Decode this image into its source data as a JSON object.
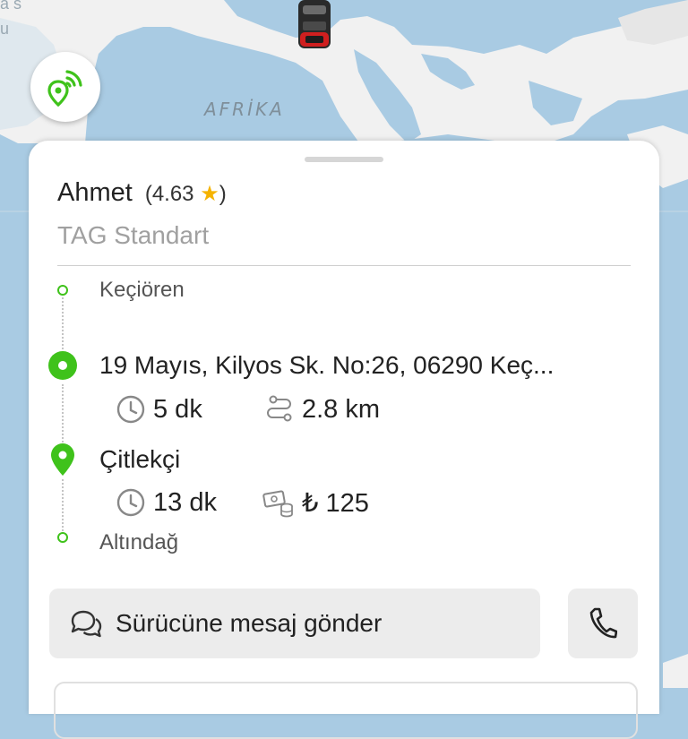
{
  "map": {
    "region_label": "AFRİKA",
    "edge_text_top": "a s",
    "edge_text_left": "u"
  },
  "colors": {
    "accent": "#3fc21b",
    "star": "#f5b300",
    "map_water": "#a9cbe3",
    "map_land": "#f2f2f2"
  },
  "driver": {
    "name": "Ahmet",
    "rating": "(4.63",
    "rating_close": ")",
    "service": "TAG Standart"
  },
  "route": {
    "previous_stop": "Keçiören",
    "pickup_address": "19 Mayıs, Kilyos Sk. No:26, 06290 Keç...",
    "pickup_time": "5 dk",
    "pickup_distance": "2.8 km",
    "destination": "Çitlekçi",
    "destination_time": "13 dk",
    "fare": "₺ 125",
    "next_stop": "Altındağ"
  },
  "actions": {
    "message_label": "Sürücüne mesaj gönder"
  },
  "icons": {
    "signal": "location-signal-icon",
    "clock": "clock-icon",
    "route": "route-icon",
    "money": "money-icon",
    "chat": "chat-icon",
    "phone": "phone-icon",
    "pin": "map-pin-icon"
  }
}
